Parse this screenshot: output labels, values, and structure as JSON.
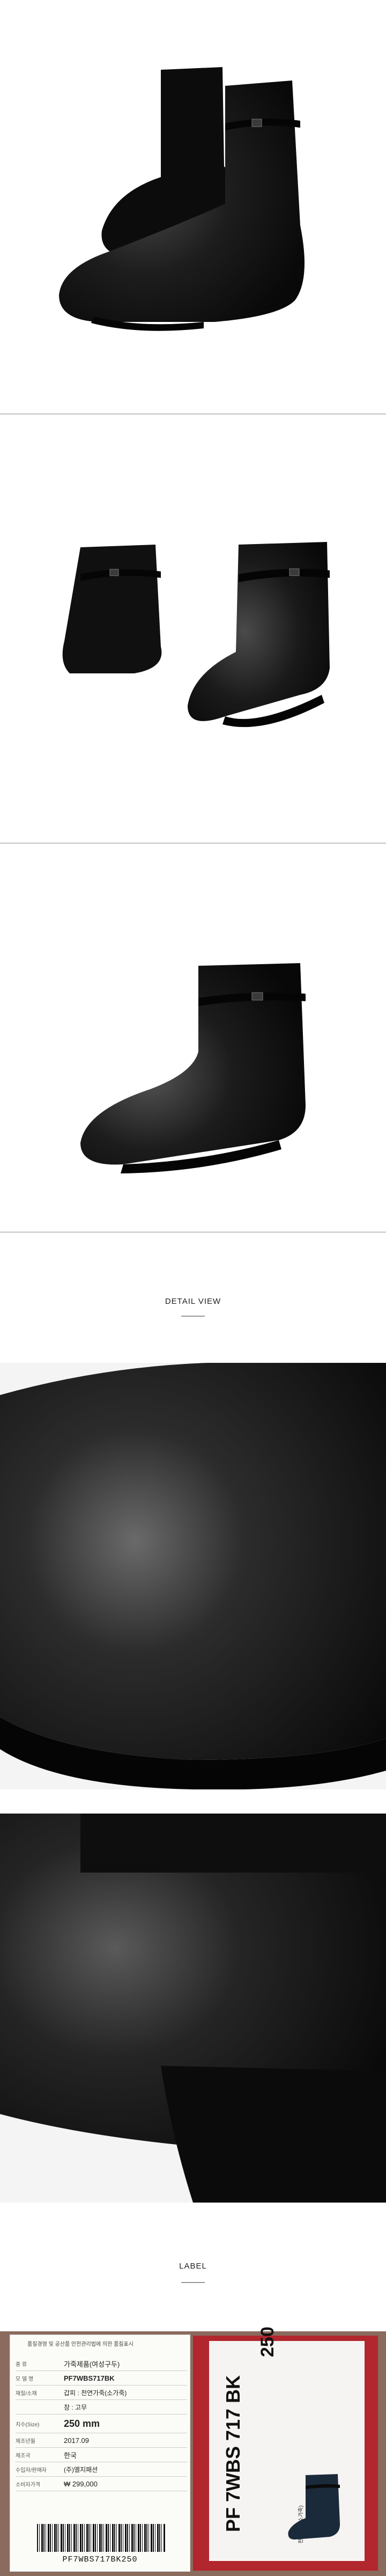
{
  "sections": {
    "detail_title": "DETAIL VIEW",
    "label_title": "LABEL"
  },
  "label": {
    "header_line1": "품질경영 및 공산품 안전관리법에 의한 품질표시",
    "header_line2": "",
    "rows": [
      {
        "k": "종      류",
        "v": "가죽제품(여성구두)"
      },
      {
        "k": "모 델 명",
        "v": "PF7WBS717BK"
      },
      {
        "k": "재질/소재",
        "v": "갑피 : 천연가죽(소가죽)"
      },
      {
        "k": "",
        "v": "창 : 고무"
      },
      {
        "k": "치수(Size)",
        "v": "250 mm"
      },
      {
        "k": "제조년월",
        "v": "2017.09"
      },
      {
        "k": "제조국",
        "v": "한국"
      },
      {
        "k": "수입자/판매자",
        "v": "(주)엘지패션"
      },
      {
        "k": "소비자가격",
        "v": "₩ 299,000"
      }
    ],
    "barcode_text": "PF7WBS717BK250",
    "tag_model": "PF 7WBS 717 BK",
    "tag_size": "250",
    "tag_small": "천연가죽(소가죽)"
  },
  "colors": {
    "leather": "#141414",
    "background": "#ffffff",
    "tag_red": "#b2262e"
  }
}
